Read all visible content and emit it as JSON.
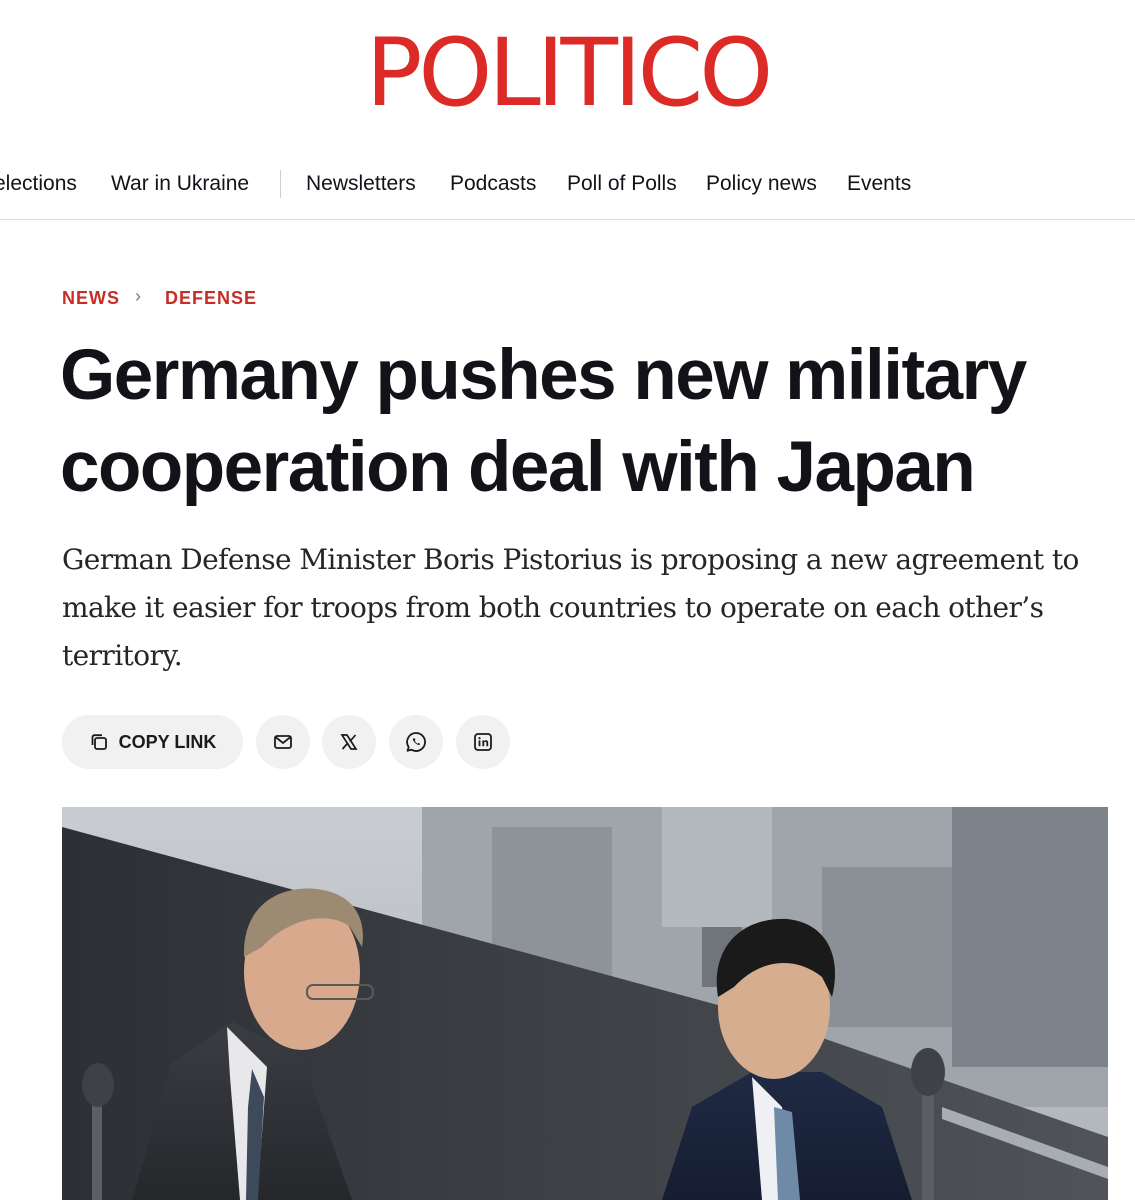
{
  "header": {
    "logo_text": "POLITICO"
  },
  "nav": {
    "items": [
      "elections",
      "War in Ukraine",
      "Newsletters",
      "Podcasts",
      "Poll of Polls",
      "Policy news",
      "Events"
    ]
  },
  "breadcrumb": {
    "section": "NEWS",
    "separator": "›",
    "subsection": "DEFENSE"
  },
  "article": {
    "headline_line1": "Germany pushes new military",
    "headline_line2": "cooperation deal with Japan",
    "dek": "German Defense Minister Boris Pistorius is proposing a new agreement to make it easier for troops from both countries to operate on each other’s territory."
  },
  "share": {
    "copy_link_label": "COPY LINK",
    "icons": [
      "copy-icon",
      "mail-icon",
      "x-icon",
      "whatsapp-icon",
      "linkedin-icon"
    ]
  },
  "photo": {
    "icons": [
      "microphone-icon"
    ]
  },
  "colors": {
    "brand": "#dc2a26",
    "kicker": "#c72d27",
    "text": "#121318",
    "button_bg": "#f1f1f1"
  }
}
